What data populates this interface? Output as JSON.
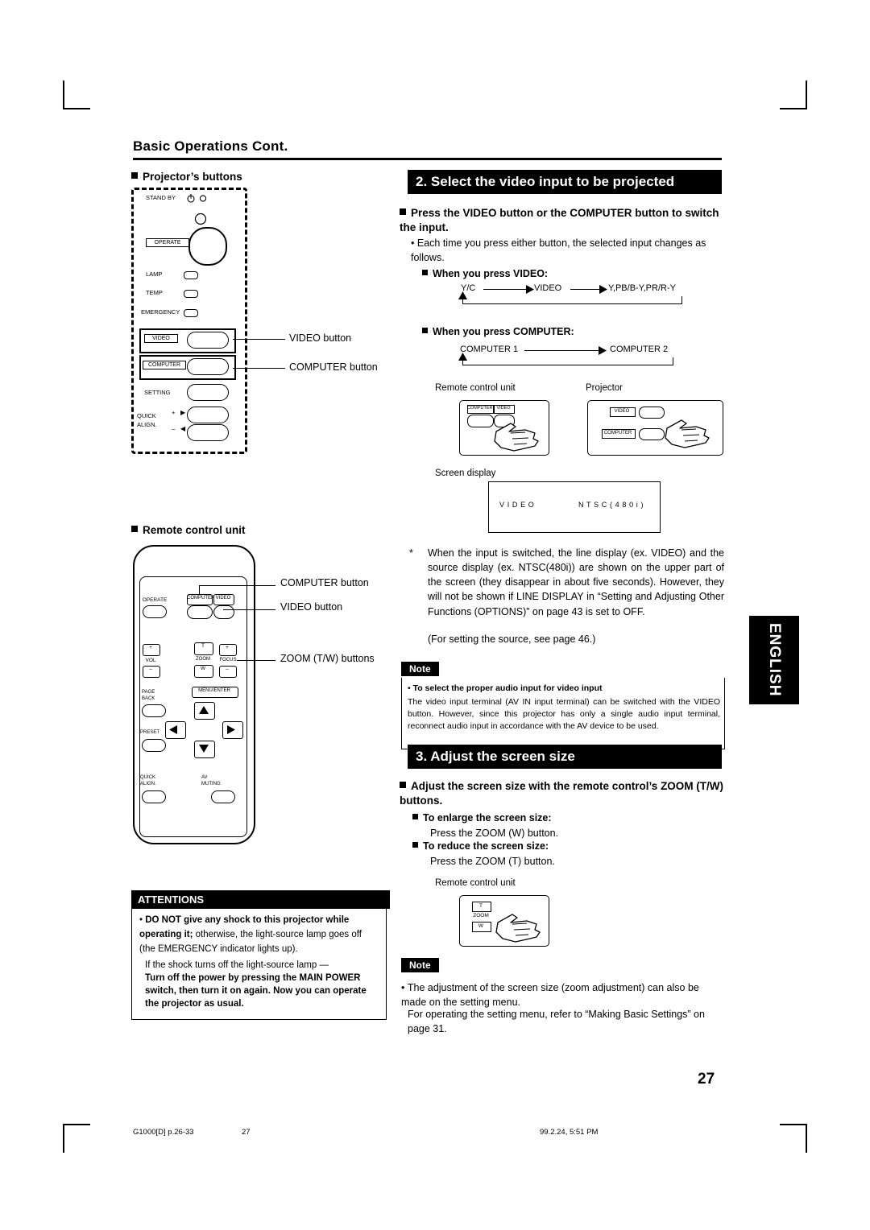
{
  "page": {
    "title": "Basic Operations Cont.",
    "number": "27",
    "english_tab": "ENGLISH"
  },
  "left": {
    "projector_heading": "Projector’s buttons",
    "projector_panel": {
      "standby_label": "STAND BY",
      "operate_label": "OPERATE",
      "lamp_label": "LAMP",
      "temp_label": "TEMP",
      "emergency_label": "EMERGENCY",
      "video_label": "VIDEO",
      "computer_label": "COMPUTER",
      "setting_label": "SETTING",
      "quick_label": "QUICK",
      "align_label": "ALIGN.",
      "plus_label": "+",
      "minus_label": "–",
      "right_arrow": "▶",
      "left_arrow": "◀"
    },
    "callouts": {
      "video_button": "VIDEO button",
      "computer_button": "COMPUTER button"
    },
    "remote_heading": "Remote control unit",
    "remote_callouts": {
      "computer_button": "COMPUTER button",
      "video_button": "VIDEO button",
      "zoom_buttons": "ZOOM (T/W) buttons"
    },
    "remote_panel": {
      "operate": "OPERATE",
      "computer": "COMPUTER",
      "video": "VIDEO",
      "vol": "VOL",
      "zoom": "ZOOM",
      "focus": "FOCUS",
      "t": "T",
      "w": "W",
      "plus": "+",
      "minus": "–",
      "page": "PAGE",
      "back": "BACK",
      "menu_enter": "MENU/ENTER",
      "preset": "PRESET",
      "quick": "QUICK",
      "align": "ALIGN.",
      "av": "AV",
      "muting": "MUTING"
    },
    "attentions": {
      "heading": "ATTENTIONS",
      "bullet_bold": "DO NOT give any shock to this projector while operating it;",
      "bullet_rest": " otherwise, the light-source lamp goes off (the EMERGENCY indicator lights up).",
      "para2": "If the shock turns off the light-source lamp —",
      "para3": "Turn off the power by pressing the MAIN POWER switch, then turn it on again. Now you can operate the projector as usual."
    }
  },
  "right": {
    "section2_title": "2. Select the video input to be projected",
    "section2_sub": "Press the VIDEO button or the COMPUTER button to switch the input.",
    "section2_bullet": "Each time you press either button, the selected input changes as follows.",
    "video_head": "When you press VIDEO:",
    "video_flow": [
      "Y/C",
      "VIDEO",
      "Y,PB/B-Y,PR/R-Y"
    ],
    "computer_head": "When you press COMPUTER:",
    "computer_flow": [
      "COMPUTER 1",
      "COMPUTER 2"
    ],
    "remote_caption": "Remote control unit",
    "projector_caption": "Projector",
    "remote_keys": {
      "computer": "COMPUTER",
      "video": "VIDEO"
    },
    "projector_keys": {
      "video": "VIDEO",
      "computer": "COMPUTER"
    },
    "screen_display_caption": "Screen display",
    "screen_display": {
      "left": "V I D E O",
      "right": "N T S C ( 4 8 0 i )"
    },
    "note_star": "*",
    "note_para": "When the input is switched, the line display (ex. VIDEO) and the source display (ex. NTSC(480i)) are shown on the upper part of the screen (they disappear in about five seconds). However, they will not be shown if LINE DISPLAY in “Setting and Adjusting Other Functions (OPTIONS)” on page 43 is set to OFF.",
    "note_para2": "(For setting the source, see page 46.)",
    "note_label": "Note",
    "note1_bold": "To select the proper audio input for video input",
    "note1_text": "The video input terminal (AV IN input terminal) can be switched with the VIDEO button. However, since this projector has only a single audio input terminal, reconnect audio input in accordance with the AV device to be used.",
    "section3_title": "3. Adjust the screen size",
    "section3_sub": "Adjust the screen size with the remote control’s ZOOM (T/W) buttons.",
    "enlarge_head": "To enlarge the screen size:",
    "enlarge_text": "Press the ZOOM (W) button.",
    "reduce_head": "To reduce the screen size:",
    "reduce_text": "Press the ZOOM (T) button.",
    "remote_caption2": "Remote control unit",
    "zoom_keys": {
      "t": "T",
      "zoom": "ZOOM",
      "w": "W"
    },
    "note2_label": "Note",
    "note2_text": "The adjustment of the screen size (zoom adjustment) can also be made on the setting menu.",
    "note2_text2": "For operating the setting menu, refer to “Making Basic Settings” on page 31."
  },
  "footer": {
    "left": "G1000[D] p.26-33",
    "center": "27",
    "right": "99.2.24, 5:51 PM"
  }
}
